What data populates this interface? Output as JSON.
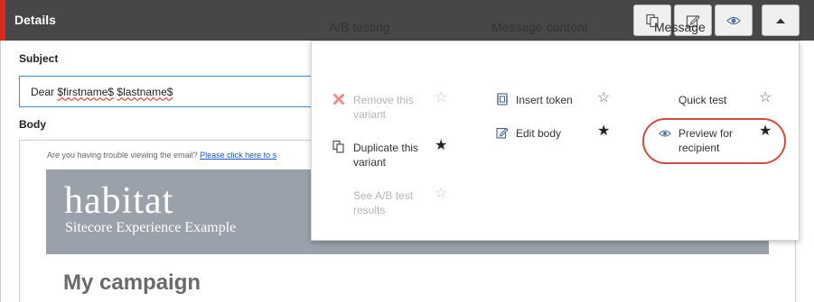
{
  "header": {
    "title": "Details",
    "buttons": [
      {
        "name": "copy-button",
        "icon": "copy-icon"
      },
      {
        "name": "edit-button",
        "icon": "edit-icon"
      },
      {
        "name": "preview-button",
        "icon": "eye-icon"
      },
      {
        "name": "collapse-button",
        "icon": "caret-up-icon"
      }
    ],
    "colors": {
      "bar": "#474747",
      "accent": "#dc291e"
    }
  },
  "form": {
    "subject_label": "Subject",
    "subject_value_prefix": "Dear ",
    "subject_token_first": "$firstname$",
    "subject_token_last": "$lastname$",
    "body_label": "Body"
  },
  "email_preview": {
    "trouble_text": "Are you having trouble viewing the email? ",
    "trouble_link": "Please click here to s",
    "brand": "habitat",
    "tagline": "Sitecore Experience Example",
    "campaign_title": "My campaign"
  },
  "menu": {
    "ab_testing": {
      "heading": "A/B testing",
      "items": [
        {
          "label_line1": "Remove this",
          "label_line2": "variant",
          "enabled": false,
          "starred": false,
          "icon": "remove-x-icon"
        },
        {
          "label_line1": "Duplicate this",
          "label_line2": "variant",
          "enabled": true,
          "starred": true,
          "icon": "duplicate-icon"
        },
        {
          "label_line1": "See A/B test",
          "label_line2": "results",
          "enabled": false,
          "starred": false,
          "icon": ""
        }
      ]
    },
    "message_content": {
      "heading": "Message content",
      "items": [
        {
          "label": "Insert token",
          "enabled": true,
          "starred": false,
          "icon": "token-icon"
        },
        {
          "label": "Edit body",
          "enabled": true,
          "starred": true,
          "icon": "edit-icon"
        }
      ]
    },
    "message": {
      "heading": "Message",
      "items": [
        {
          "label": "Quick test",
          "enabled": true,
          "starred": false,
          "icon": ""
        },
        {
          "label_line1": "Preview for",
          "label_line2": "recipient",
          "enabled": true,
          "starred": true,
          "icon": "eye-icon",
          "highlighted": true
        }
      ]
    }
  },
  "glyphs": {
    "star_empty": "☆",
    "star_full": "★"
  }
}
